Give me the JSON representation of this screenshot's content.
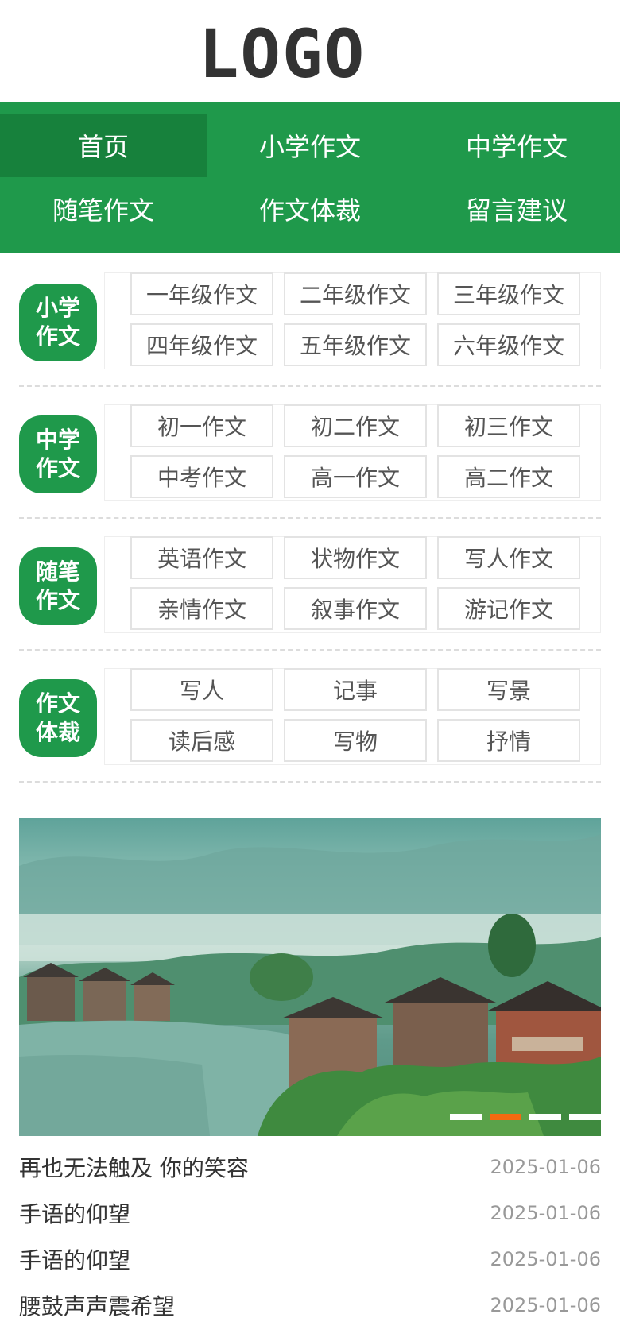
{
  "logo": {
    "text": "LOGO"
  },
  "nav": {
    "items": [
      {
        "label": "首页",
        "active": true
      },
      {
        "label": "小学作文"
      },
      {
        "label": "中学作文"
      },
      {
        "label": "随笔作文"
      },
      {
        "label": "作文体裁"
      },
      {
        "label": "留言建议"
      }
    ]
  },
  "categories": [
    {
      "badge": [
        "小学",
        "作文"
      ],
      "links": [
        "一年级作文",
        "二年级作文",
        "三年级作文",
        "四年级作文",
        "五年级作文",
        "六年级作文"
      ]
    },
    {
      "badge": [
        "中学",
        "作文"
      ],
      "links": [
        "初一作文",
        "初二作文",
        "初三作文",
        "中考作文",
        "高一作文",
        "高二作文"
      ]
    },
    {
      "badge": [
        "随笔",
        "作文"
      ],
      "links": [
        "英语作文",
        "状物作文",
        "写人作文",
        "亲情作文",
        "叙事作文",
        "游记作文"
      ]
    },
    {
      "badge": [
        "作文",
        "体裁"
      ],
      "links": [
        "写人",
        "记事",
        "写景",
        "读后感",
        "写物",
        "抒情"
      ]
    }
  ],
  "banner": {
    "active_slide": 2,
    "slide_count": 4,
    "colors": {
      "brand": "#1f994b",
      "active_dot": "#f26a10"
    }
  },
  "articles": [
    {
      "title": "再也无法触及 你的笑容",
      "date": "2025-01-06"
    },
    {
      "title": "手语的仰望",
      "date": "2025-01-06"
    },
    {
      "title": "手语的仰望",
      "date": "2025-01-06"
    },
    {
      "title": "腰鼓声声震希望",
      "date": "2025-01-06"
    }
  ]
}
